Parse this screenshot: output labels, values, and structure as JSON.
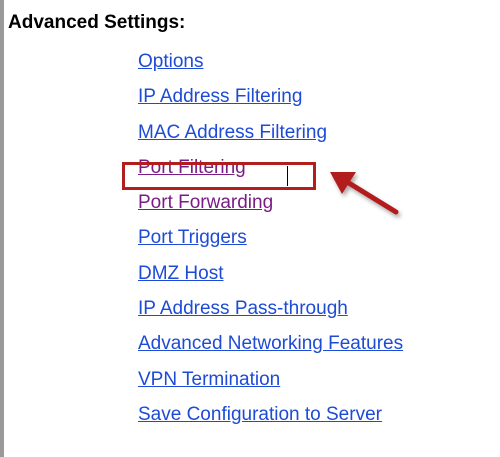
{
  "settings": {
    "title": "Advanced Settings:",
    "links": [
      {
        "label": "Options"
      },
      {
        "label": "IP Address Filtering"
      },
      {
        "label": "MAC Address Filtering"
      },
      {
        "label": "Port Filtering"
      },
      {
        "label": "Port Forwarding"
      },
      {
        "label": "Port Triggers"
      },
      {
        "label": "DMZ Host"
      },
      {
        "label": "IP Address Pass-through"
      },
      {
        "label": "Advanced Networking Features"
      },
      {
        "label": "VPN Termination"
      },
      {
        "label": "Save Configuration to Server"
      }
    ]
  },
  "annotation": {
    "highlight_target": "Port Filtering",
    "highlight_color": "#b21e1e",
    "arrow_icon": "arrow-pointing-up-left-icon"
  },
  "colors": {
    "link": "#1d4bd6",
    "visited_link": "#7a1c86"
  }
}
